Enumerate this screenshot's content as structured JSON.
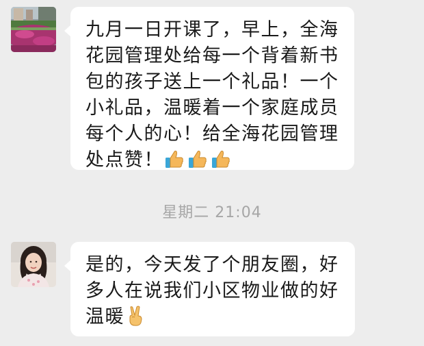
{
  "messages": [
    {
      "sender": "garden-avatar",
      "lines": [
        "九月一日开课了，早上，全海",
        "花园管理处给每一个背着新书",
        "包的孩子送上一个礼品！一个",
        "小礼品，温暖着一个家庭成员",
        "每个人的心！给全海花园管理"
      ],
      "last_line_text": "处点赞！",
      "emojis": [
        "thumbs-up",
        "thumbs-up",
        "thumbs-up"
      ]
    },
    {
      "sender": "person-avatar",
      "lines": [
        "是的，今天发了个朋友圈，好",
        "多人在说我们小区物业做的好"
      ],
      "last_line_text": "温暖",
      "emojis": [
        "victory-hand"
      ]
    }
  ],
  "timestamp": "星期二 21:04",
  "colors": {
    "background": "#ededed",
    "bubble": "#ffffff",
    "text": "#1a1a1a",
    "timestamp": "#a6a6a6"
  }
}
